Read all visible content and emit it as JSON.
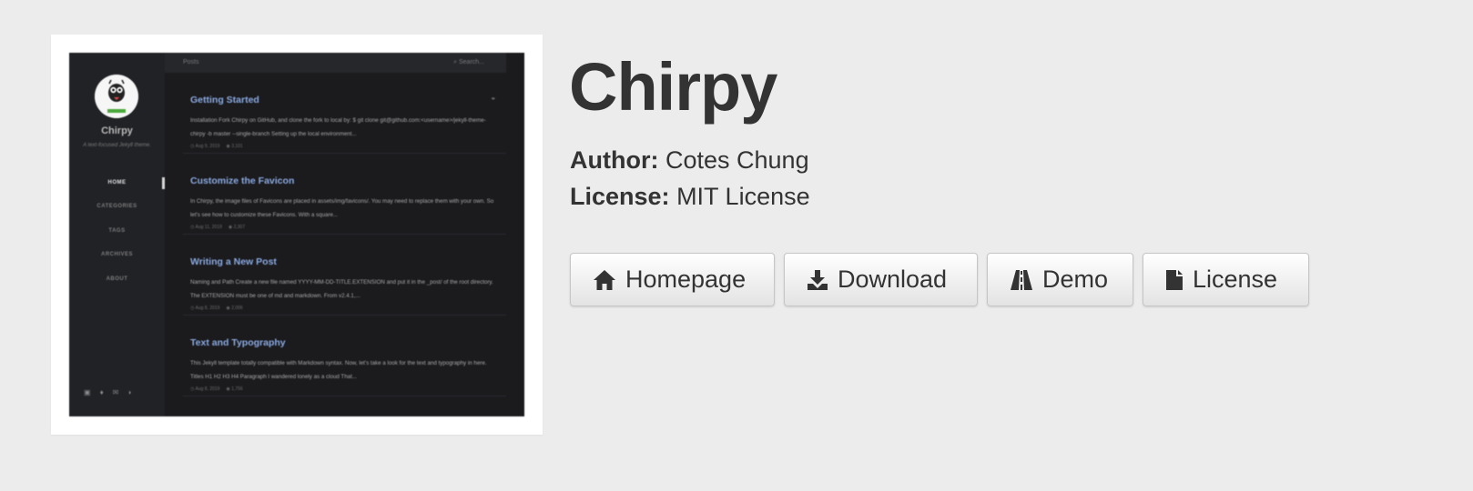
{
  "theme": {
    "title": "Chirpy",
    "author_label": "Author:",
    "author": "Cotes Chung",
    "license_label": "License:",
    "license": "MIT License"
  },
  "buttons": {
    "homepage": {
      "label": "Homepage",
      "icon": "home-icon"
    },
    "download": {
      "label": "Download",
      "icon": "download-icon"
    },
    "demo": {
      "label": "Demo",
      "icon": "road-icon"
    },
    "license": {
      "label": "License",
      "icon": "file-icon"
    }
  },
  "preview": {
    "site_title": "Chirpy",
    "site_subtitle": "A text-focused Jekyll theme.",
    "topbar_title": "Posts",
    "search_placeholder": "Search...",
    "nav": [
      "HOME",
      "CATEGORIES",
      "TAGS",
      "ARCHIVES",
      "ABOUT"
    ],
    "posts": [
      {
        "title": "Getting Started",
        "excerpt": "Installation Fork Chirpy on GitHub, and clone the fork to local by: $ git clone git@github.com:<username>/jekyll-theme-chirpy -b master --single-branch Setting up the local environment...",
        "date": "Aug 9, 2019",
        "views": "3,101"
      },
      {
        "title": "Customize the Favicon",
        "excerpt": "In Chirpy, the image files of Favicons are placed in assets/img/favicons/. You may need to replace them with your own. So let's see how to customize these Favicons. With a square...",
        "date": "Aug 11, 2019",
        "views": "2,307"
      },
      {
        "title": "Writing a New Post",
        "excerpt": "Naming and Path Create a new file named YYYY-MM-DD-TITLE.EXTENSION and put it in the _post/ of the root directory. The EXTENSION must be one of md and markdown. From v2.4.1,...",
        "date": "Aug 8, 2019",
        "views": "2,006"
      },
      {
        "title": "Text and Typography",
        "excerpt": "This Jekyll template totally compatible with Markdown syntax. Now, let's take a look for the text and typography in here. Titles H1 H2 H3 H4 Paragraph I wandered lonely as a cloud That...",
        "date": "Aug 8, 2019",
        "views": "1,756"
      }
    ]
  },
  "colors": {
    "background": "#ececec",
    "preview_bg": "#1b1b1e",
    "preview_link": "#8aa9e0",
    "text": "#333333"
  }
}
